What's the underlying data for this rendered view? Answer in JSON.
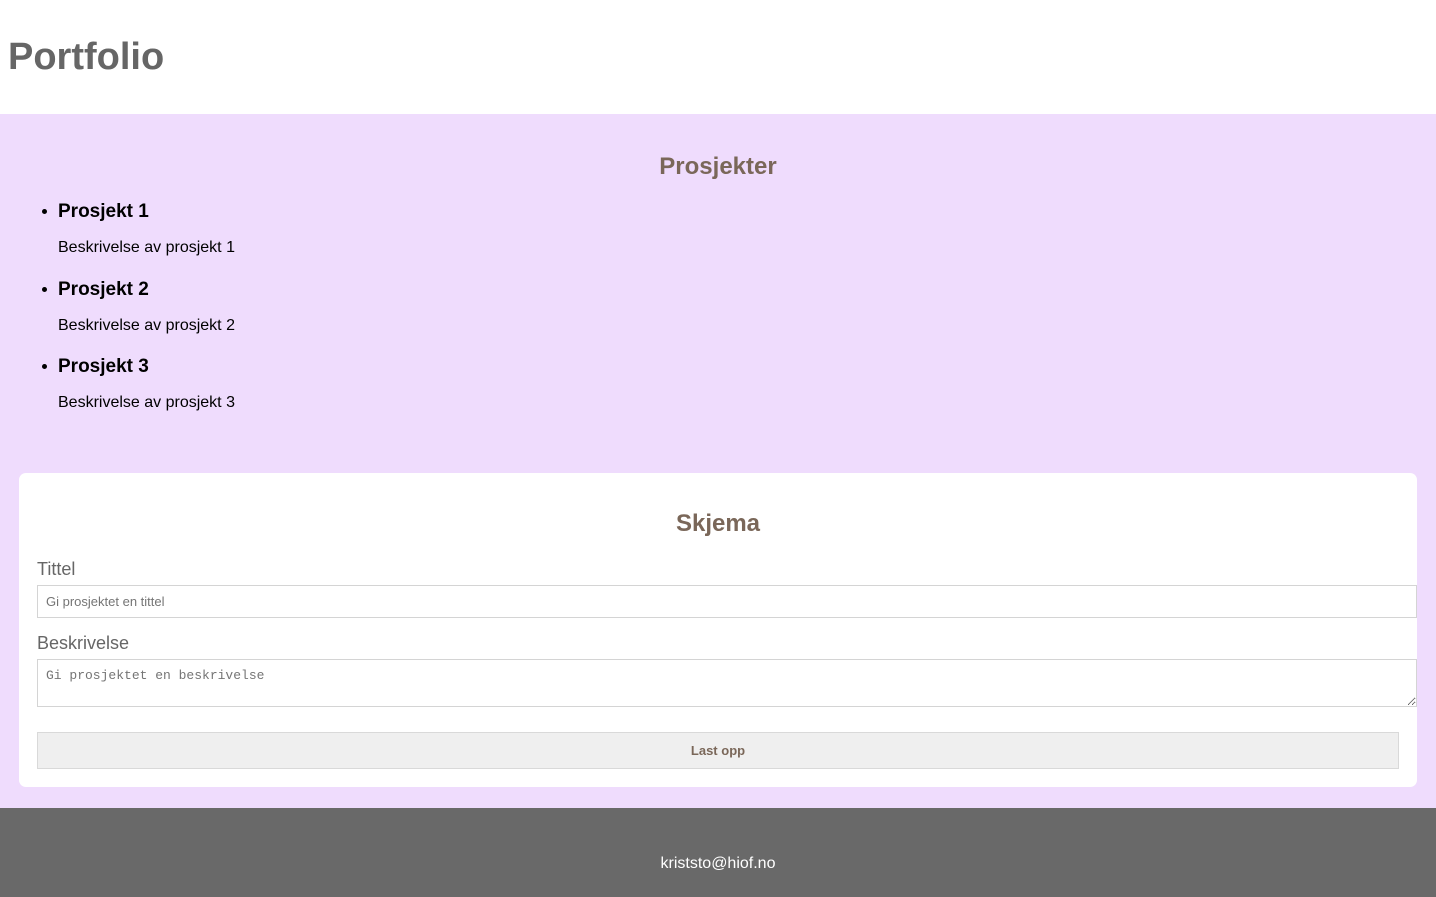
{
  "header": {
    "title": "Portfolio"
  },
  "projects": {
    "heading": "Prosjekter",
    "items": [
      {
        "title": "Prosjekt 1",
        "description": "Beskrivelse av prosjekt 1"
      },
      {
        "title": "Prosjekt 2",
        "description": "Beskrivelse av prosjekt 2"
      },
      {
        "title": "Prosjekt 3",
        "description": "Beskrivelse av prosjekt 3"
      }
    ]
  },
  "form": {
    "heading": "Skjema",
    "title_label": "Tittel",
    "title_placeholder": "Gi prosjektet en tittel",
    "title_value": "",
    "description_label": "Beskrivelse",
    "description_placeholder": "Gi prosjektet en beskrivelse",
    "description_value": "",
    "submit_label": "Last opp"
  },
  "footer": {
    "email": "kriststo@hiof.no"
  },
  "colors": {
    "main_background": "#efdcfd",
    "heading_color": "#7a6759",
    "footer_background": "#696969"
  }
}
